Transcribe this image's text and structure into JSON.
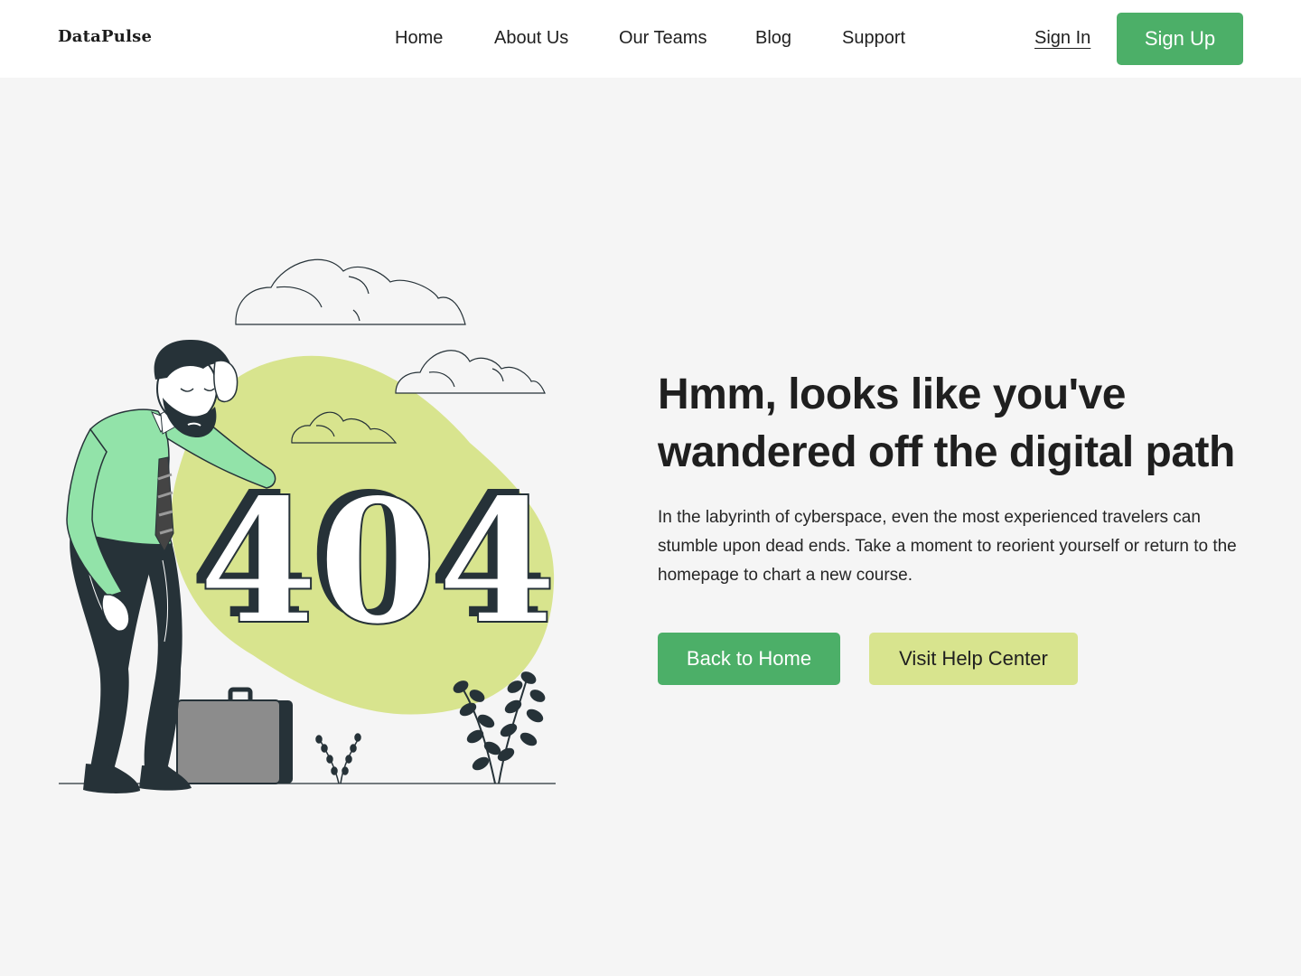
{
  "brand": "DataPulse",
  "nav": {
    "links": [
      "Home",
      "About Us",
      "Our Teams",
      "Blog",
      "Support"
    ],
    "sign_in": "Sign In",
    "sign_up": "Sign Up"
  },
  "illustration": {
    "error_code": "404"
  },
  "hero": {
    "headline": "Hmm, looks like you've wandered off the digital path",
    "description": "In the labyrinth of cyberspace, even the most experienced travelers can stumble upon dead ends. Take a moment to reorient yourself or return to the homepage to chart a new course.",
    "primary_button": "Back to Home",
    "secondary_button": "Visit Help Center"
  },
  "colors": {
    "primary": "#4caf68",
    "secondary": "#d8e48e",
    "shirt": "#92e3a9",
    "dark": "#263238",
    "background": "#f5f5f5"
  }
}
